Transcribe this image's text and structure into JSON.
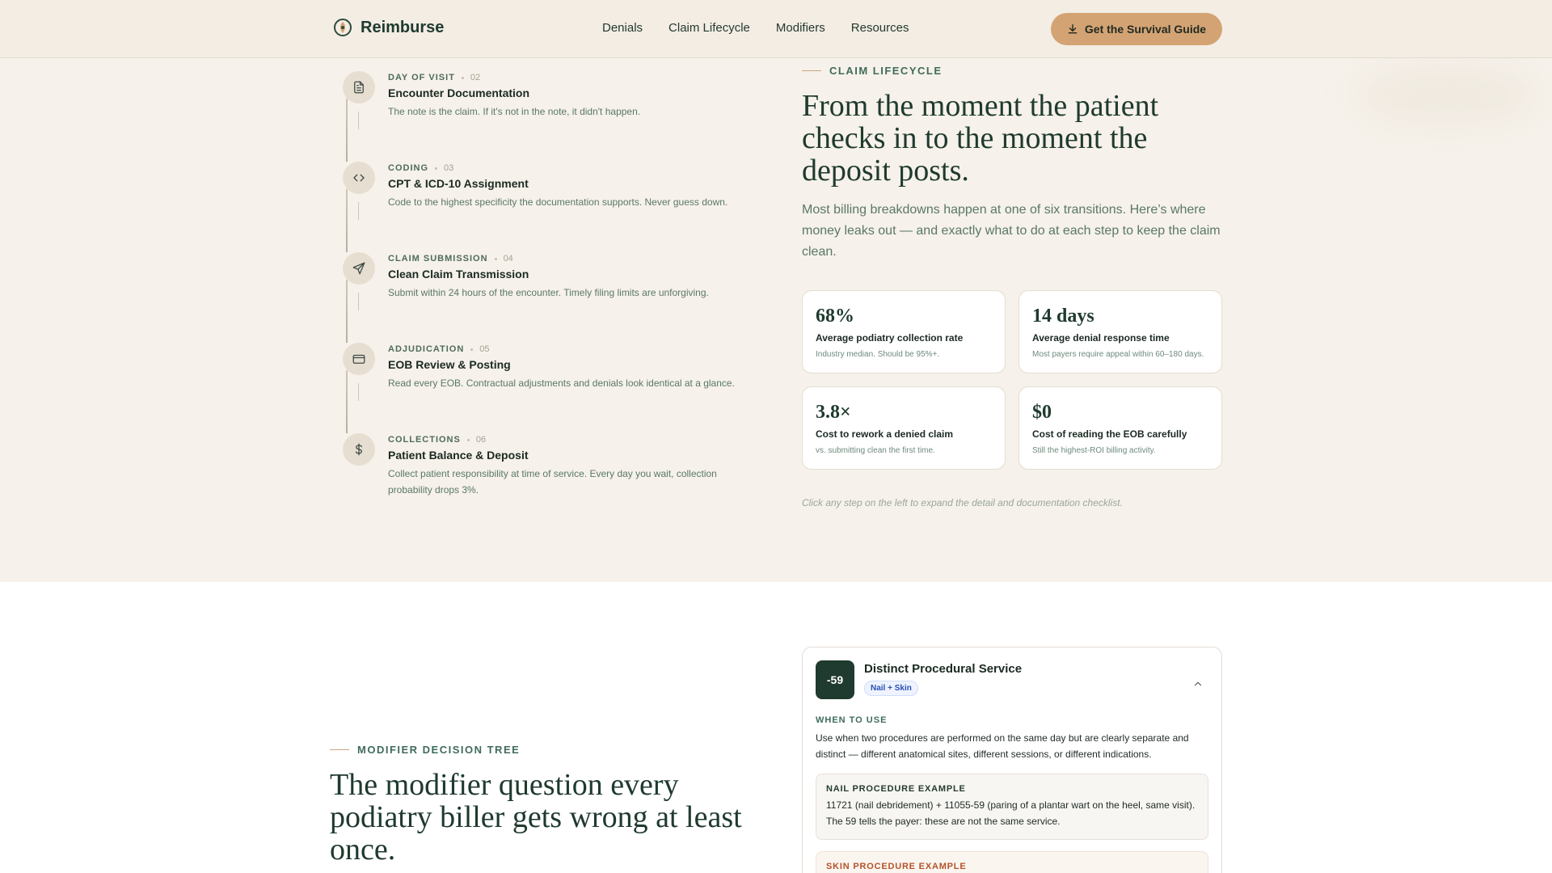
{
  "header": {
    "brand": "Reimburse",
    "nav": [
      "Denials",
      "Claim Lifecycle",
      "Modifiers",
      "Resources"
    ],
    "cta": "Get the Survival Guide"
  },
  "timeline": {
    "steps": [
      {
        "kicker": "DAY OF VISIT",
        "num": "02",
        "title": "Encounter Documentation",
        "desc": "The note is the claim. If it's not in the note, it didn't happen.",
        "icon": "document-icon"
      },
      {
        "kicker": "CODING",
        "num": "03",
        "title": "CPT & ICD-10 Assignment",
        "desc": "Code to the highest specificity the documentation supports. Never guess down.",
        "icon": "code-icon"
      },
      {
        "kicker": "CLAIM SUBMISSION",
        "num": "04",
        "title": "Clean Claim Transmission",
        "desc": "Submit within 24 hours of the encounter. Timely filing limits are unforgiving.",
        "icon": "send-icon"
      },
      {
        "kicker": "ADJUDICATION",
        "num": "05",
        "title": "EOB Review & Posting",
        "desc": "Read every EOB. Contractual adjustments and denials look identical at a glance.",
        "icon": "card-icon"
      },
      {
        "kicker": "COLLECTIONS",
        "num": "06",
        "title": "Patient Balance & Deposit",
        "desc": "Collect patient responsibility at time of service. Every day you wait, collection probability drops 3%.",
        "icon": "dollar-icon"
      }
    ]
  },
  "lifecycle": {
    "eyebrow": "CLAIM LIFECYCLE",
    "headline": "From the moment the patient checks in to the moment the deposit posts.",
    "lede": "Most billing breakdowns happen at one of six transitions. Here’s where money leaks out — and exactly what to do at each step to keep the claim clean.",
    "stats": [
      {
        "value": "68%",
        "label": "Average podiatry collection rate",
        "note": "Industry median. Should be 95%+."
      },
      {
        "value": "14 days",
        "label": "Average denial response time",
        "note": "Most payers require appeal within 60–180 days."
      },
      {
        "value": "3.8×",
        "label": "Cost to rework a denied claim",
        "note": "vs. submitting clean the first time."
      },
      {
        "value": "$0",
        "label": "Cost of reading the EOB carefully",
        "note": "Still the highest-ROI billing activity."
      }
    ],
    "hint": "Click any step on the left to expand the detail and documentation checklist."
  },
  "modifiers": {
    "eyebrow": "MODIFIER DECISION TREE",
    "headline": "The modifier question every podiatry biller gets wrong at least once.",
    "card": {
      "code": "-59",
      "title": "Distinct Procedural Service",
      "tag": "Nail + Skin",
      "when_kicker": "WHEN TO USE",
      "when_text": "Use when two procedures are performed on the same day but are clearly separate and distinct — different anatomical sites, different sessions, or different indications.",
      "nail_kicker": "NAIL PROCEDURE EXAMPLE",
      "nail_text": "11721 (nail debridement) + 11055-59 (paring of a plantar wart on the heel, same visit). The 59 tells the payer: these are not the same service.",
      "skin_kicker": "SKIN PROCEDURE EXAMPLE"
    }
  }
}
